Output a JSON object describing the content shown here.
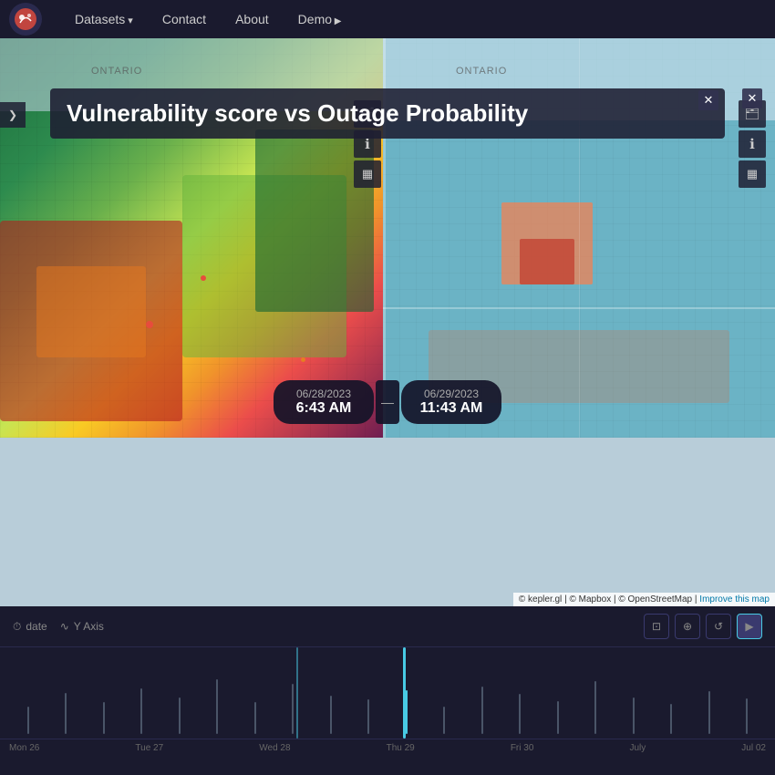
{
  "navbar": {
    "datasets_label": "Datasets",
    "contact_label": "Contact",
    "about_label": "About",
    "demo_label": "Demo"
  },
  "title": {
    "main": "Vulnerability score vs Outage Probability"
  },
  "map": {
    "left_label": "ONTARIO",
    "right_label": "ONTARIO",
    "divider_time_left": "06/28/2023",
    "divider_time_right": "06/29/2023",
    "time_left": "6:43 AM",
    "time_right": "11:43 AM"
  },
  "timeline": {
    "date_label": "date",
    "y_axis_label": "Y Axis",
    "axis_labels": [
      "Mon 26",
      "Tue 27",
      "Wed 28",
      "Thu 29",
      "Fri 30",
      "July",
      "Jul 02"
    ],
    "play_icon": "▶"
  },
  "attribution": {
    "kepler": "© kepler.gl",
    "mapbox": "© Mapbox",
    "openstreetmap": "© OpenStreetMap",
    "improve": "Improve this map"
  },
  "icons": {
    "close": "✕",
    "sidebar_toggle": "❯",
    "layers": "⊞",
    "info": "ℹ",
    "grid": "⊟",
    "camera": "⊡",
    "compass": "⊕",
    "reset": "↺",
    "play": "▶",
    "clock": "⏱",
    "trend": "∿",
    "grid_small": "⊞"
  }
}
